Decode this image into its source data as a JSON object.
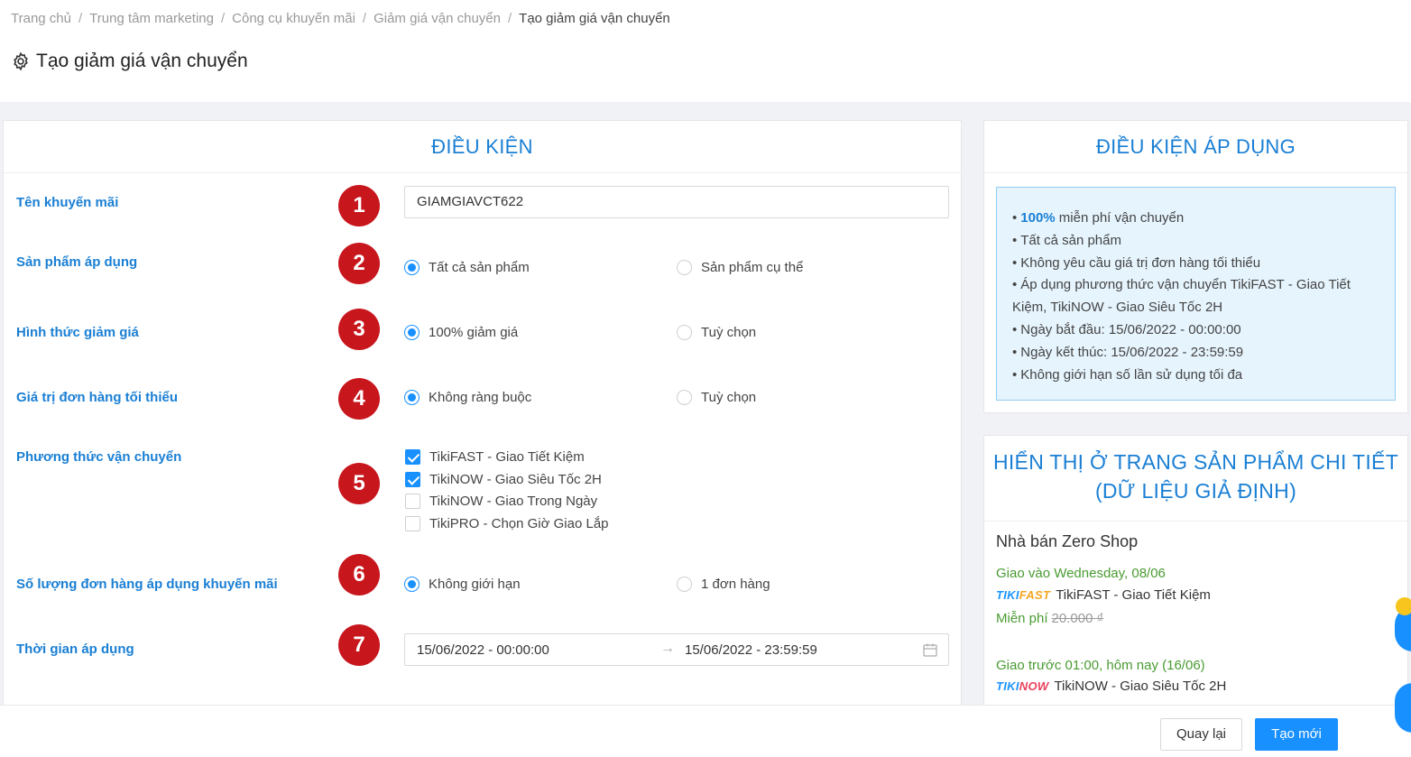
{
  "breadcrumb": [
    "Trang chủ",
    "Trung tâm marketing",
    "Công cụ khuyến mãi",
    "Giảm giá vận chuyển",
    "Tạo giảm giá vận chuyển"
  ],
  "page_title": "Tạo giảm giá vận chuyển",
  "conditions": {
    "title": "ĐIỀU KIỆN",
    "rows": [
      {
        "num": "1",
        "label": "Tên khuyến mãi"
      },
      {
        "num": "2",
        "label": "Sản phẩm áp dụng"
      },
      {
        "num": "3",
        "label": "Hình thức giảm giá"
      },
      {
        "num": "4",
        "label": "Giá trị đơn hàng tối thiểu"
      },
      {
        "num": "5",
        "label": "Phương thức vận chuyển"
      },
      {
        "num": "6",
        "label": "Số lượng đơn hàng áp dụng khuyến mãi"
      },
      {
        "num": "7",
        "label": "Thời gian áp dụng"
      }
    ],
    "promo_name": "GIAMGIAVCT622",
    "product_options": [
      "Tất cả sản phẩm",
      "Sản phẩm cụ thể"
    ],
    "discount_options": [
      "100% giảm giá",
      "Tuỳ chọn"
    ],
    "min_order_options": [
      "Không ràng buộc",
      "Tuỳ chọn"
    ],
    "shipping_methods": [
      {
        "label": "TikiFAST - Giao Tiết Kiệm",
        "checked": true
      },
      {
        "label": "TikiNOW - Giao Siêu Tốc 2H",
        "checked": true
      },
      {
        "label": "TikiNOW - Giao Trong Ngày",
        "checked": false
      },
      {
        "label": "TikiPRO - Chọn Giờ Giao Lắp",
        "checked": false
      }
    ],
    "order_count_options": [
      "Không giới hạn",
      "1 đơn hàng"
    ],
    "date_start": "15/06/2022 - 00:00:00",
    "date_arrow": "→",
    "date_end": "15/06/2022 - 23:59:59"
  },
  "applied": {
    "title": "ĐIỀU KIỆN ÁP DỤNG",
    "bullet": "•",
    "highlight": "100%",
    "first_rest": " miễn phí vận chuyển",
    "items": [
      "Tất cả sản phẩm",
      "Không yêu cầu giá trị đơn hàng tối thiểu",
      "Áp dụng phương thức vận chuyển TikiFAST - Giao Tiết",
      "Kiệm, TikiNOW - Giao Siêu Tốc 2H",
      "Ngày bắt đầu: 15/06/2022 - 00:00:00",
      "Ngày kết thúc: 15/06/2022 - 23:59:59",
      "Không giới hạn số lần sử dụng tối đa"
    ]
  },
  "preview": {
    "title_line1": "HIỂN THỊ Ở TRANG SẢN PHẨM CHI TIẾT",
    "title_line2": "(DỮ LIỆU GIẢ ĐỊNH)",
    "seller": "Nhà bán Zero Shop",
    "delivery1": "Giao vào Wednesday, 08/06",
    "logo1": {
      "a": "TIKI",
      "b": "FAST"
    },
    "method1": "TikiFAST - Giao Tiết Kiệm",
    "free_label": "Miễn phí",
    "old_price": "20.000 ₫",
    "delivery2": "Giao trước 01:00, hôm nay (16/06)",
    "logo2": {
      "a": "TIKI",
      "c": "NOW"
    },
    "method2": "TikiNOW - Giao Siêu Tốc 2H"
  },
  "footer": {
    "back": "Quay lại",
    "create": "Tạo mới"
  },
  "colors": {
    "accent": "#1a7fd4",
    "primary": "#1890ff",
    "badge": "#c8161d",
    "green": "#4a9b32"
  }
}
